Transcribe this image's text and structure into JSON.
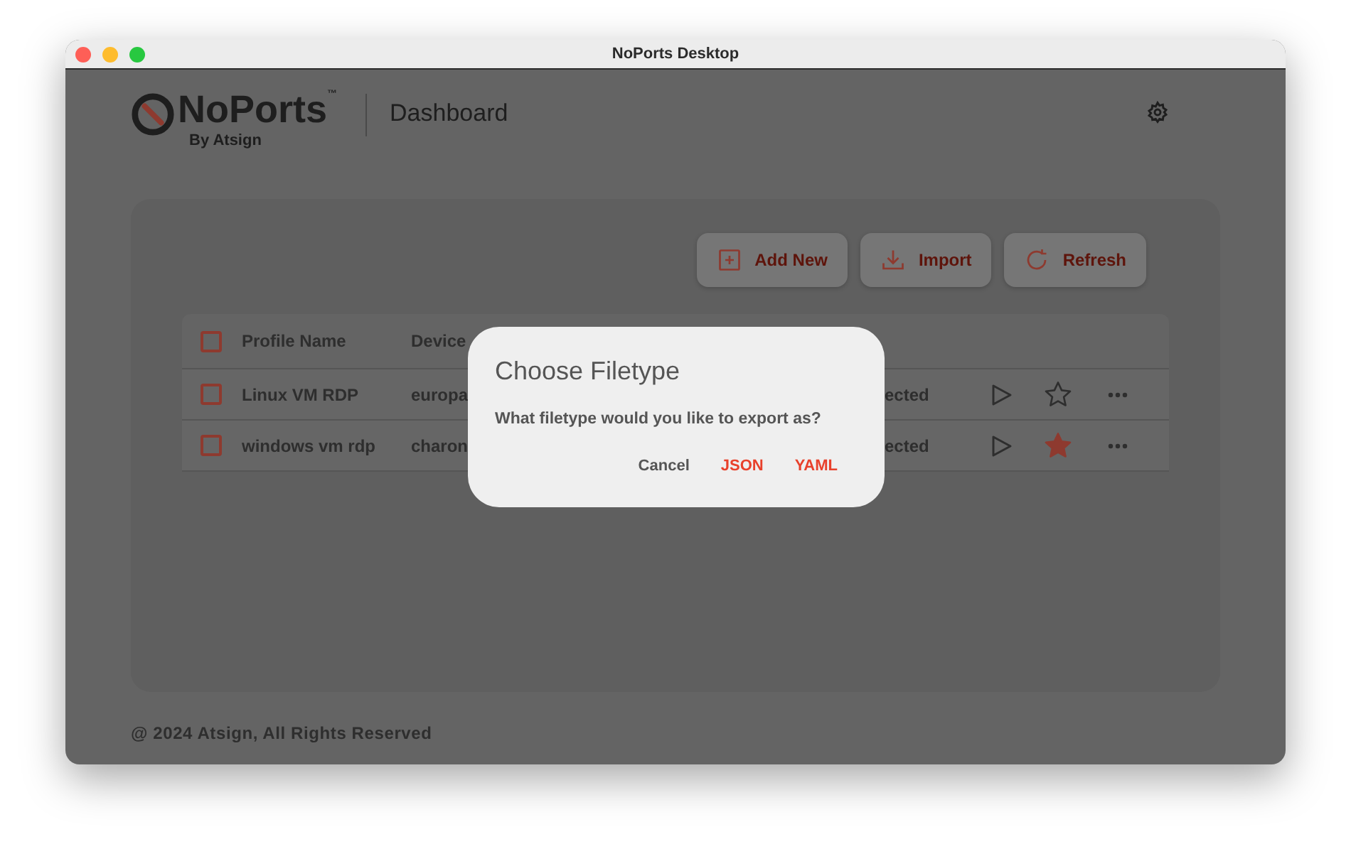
{
  "window": {
    "title": "NoPorts Desktop"
  },
  "logo": {
    "name": "NoPorts$^{™}$",
    "tagline": "By Atsign"
  },
  "page_title": "Dashboard",
  "toolbar": [
    {
      "label": "Add New",
      "kind": "add"
    },
    {
      "label": "Import",
      "kind": "import"
    },
    {
      "label": "Refresh",
      "kind": "refresh"
    }
  ],
  "table": {
    "select_all": {
      "checked": false
    },
    "columns": [
      "Profile Name",
      "Device"
    ],
    "rows": [
      {
        "checked": false,
        "name": "Linux VM RDP",
        "device": "europa",
        "status": "ected",
        "favorite": false
      },
      {
        "checked": false,
        "name": "windows vm rdp",
        "device": "charon",
        "status": "ected",
        "favorite": true
      }
    ]
  },
  "footer": "@ 2024 Atsign, All Rights Reserved",
  "dialog": {
    "title": "Choose Filetype",
    "message": "What filetype would you like to export as?",
    "buttons": [
      {
        "label": "Cancel",
        "kind": "neutral"
      },
      {
        "label": "JSON",
        "kind": "accent"
      },
      {
        "label": "YAML",
        "kind": "accent"
      }
    ]
  }
}
